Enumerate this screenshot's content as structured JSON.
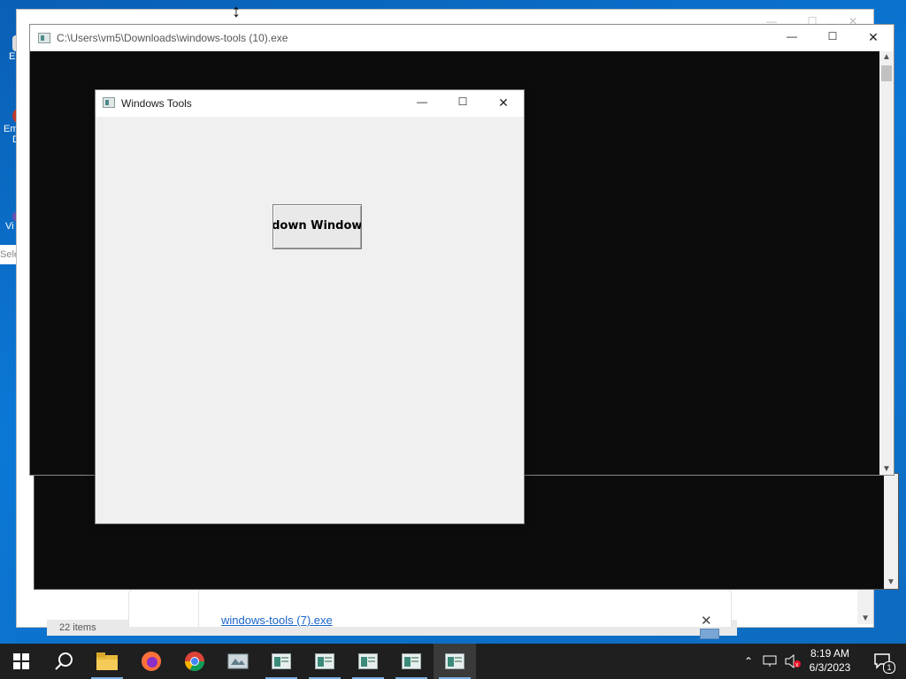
{
  "desktop": {
    "icon_labels": [
      "E",
      "Em",
      "D",
      "Vi"
    ],
    "selection_text": "Sele"
  },
  "explorer": {
    "status_items": "22 items",
    "download_file": "windows-tools (7).exe"
  },
  "console": {
    "title": "C:\\Users\\vm5\\Downloads\\windows-tools (10).exe"
  },
  "tools_window": {
    "title": "Windows Tools",
    "shutdown_button_label": "Shutdown Windows"
  },
  "titlebar_buttons": {
    "minimize": "—",
    "maximize": "☐",
    "close": "✕"
  },
  "taskbar": {
    "pinned": [
      "start-icon",
      "search-icon",
      "file-explorer-icon",
      "firefox-icon",
      "chrome-icon",
      "app-icon",
      "windows-tools-icon",
      "windows-tools-icon",
      "windows-tools-icon",
      "windows-tools-icon",
      "windows-tools-icon"
    ],
    "time": "8:19 AM",
    "date": "6/3/2023",
    "notification_count": "1"
  },
  "colors": {
    "accent": "#7fb2e6",
    "console_bg": "#0c0c0c",
    "dialog_bg": "#f0f0f0",
    "link": "#1a64c8"
  }
}
